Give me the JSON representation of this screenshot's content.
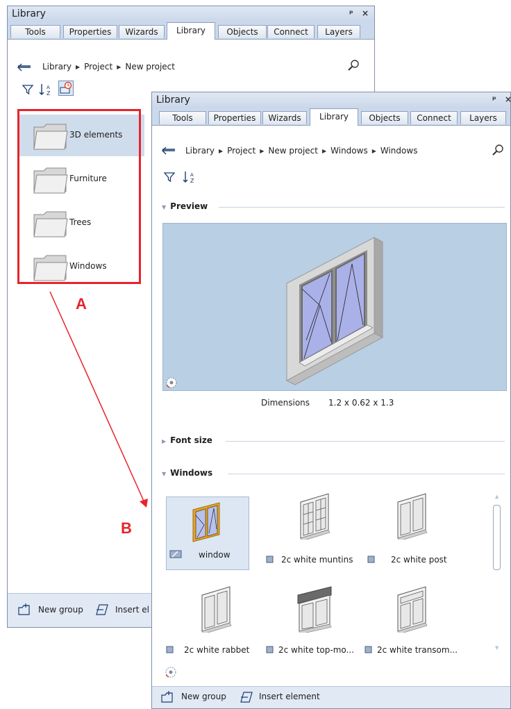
{
  "back_panel": {
    "title": "Library",
    "window_buttons": "ᵖ ×",
    "tabs": [
      "Tools",
      "Properties",
      "Wizards",
      "Library",
      "Objects",
      "Connect",
      "Layers"
    ],
    "breadcrumb": [
      "Library",
      "Project",
      "New project"
    ],
    "folders": [
      "3D elements",
      "Furniture",
      "Trees",
      "Windows"
    ],
    "bottom": {
      "new_group": "New group",
      "insert": "Insert el"
    }
  },
  "annotations": {
    "label_a": "A",
    "label_b": "B",
    "highlight_color": "#e8232a"
  },
  "front_panel": {
    "title": "Library",
    "window_buttons": "ᵖ ×",
    "tabs": [
      "Tools",
      "Properties",
      "Wizards",
      "Library",
      "Objects",
      "Connect",
      "Layers"
    ],
    "breadcrumb": [
      "Library",
      "Project",
      "New project",
      "Windows",
      "Windows"
    ],
    "preview_header": "Preview",
    "dimensions_label": "Dimensions",
    "dimensions_value": "1.2 x 0.62 x 1.3",
    "font_size_header": "Font size",
    "windows_header": "Windows",
    "items": [
      "window",
      "2c white muntins",
      "2c white post",
      "2c white rabbet",
      "2c white top-mo...",
      "2c white transom..."
    ],
    "bottom": {
      "new_group": "New group",
      "insert": "Insert element"
    }
  },
  "colors": {
    "preview_bg": "#b9cfe4",
    "selected_bg": "#dce7f3",
    "panel_header": "#cbd9ec"
  }
}
